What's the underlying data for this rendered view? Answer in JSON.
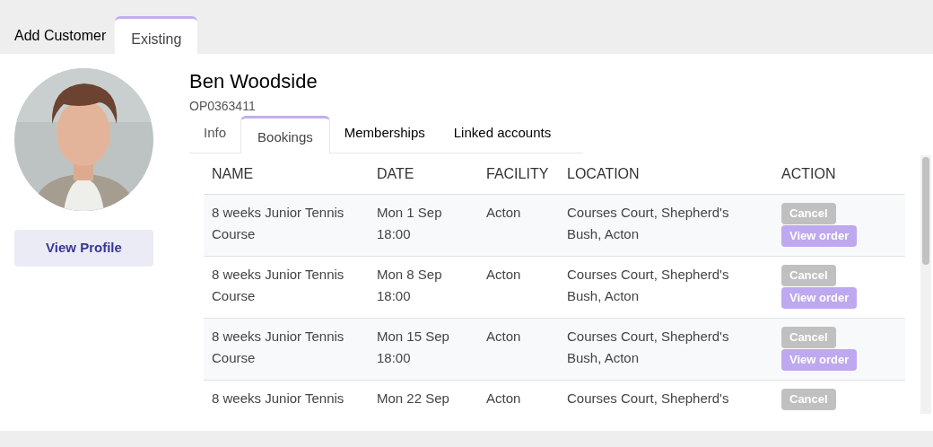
{
  "top_tabs": [
    {
      "label": "Add Customer",
      "selected": false
    },
    {
      "label": "Existing",
      "selected": true
    }
  ],
  "profile": {
    "button": "View Profile"
  },
  "customer": {
    "name": "Ben Woodside",
    "id": "OP0363411"
  },
  "tabs": [
    {
      "label": "Info",
      "selected": false
    },
    {
      "label": "Bookings",
      "selected": true
    },
    {
      "label": "Memberships",
      "selected": false
    },
    {
      "label": "Linked accounts",
      "selected": false
    }
  ],
  "table": {
    "columns": [
      "NAME",
      "DATE",
      "FACILITY",
      "LOCATION",
      "ACTION"
    ],
    "rows": [
      {
        "name": "8 weeks Junior Tennis Course",
        "date": "Mon 1 Sep 18:00",
        "facility": "Acton",
        "location": "Courses Court, Shepherd's Bush, Acton",
        "actions": [
          "Cancel",
          "View order"
        ]
      },
      {
        "name": "8 weeks Junior Tennis Course",
        "date": "Mon 8 Sep 18:00",
        "facility": "Acton",
        "location": "Courses Court, Shepherd's Bush, Acton",
        "actions": [
          "Cancel",
          "View order"
        ]
      },
      {
        "name": "8 weeks Junior Tennis Course",
        "date": "Mon 15 Sep 18:00",
        "facility": "Acton",
        "location": "Courses Court, Shepherd's Bush, Acton",
        "actions": [
          "Cancel",
          "View order"
        ]
      },
      {
        "name": "8 weeks Junior Tennis",
        "date": "Mon 22 Sep",
        "facility": "Acton",
        "location": "Courses Court, Shepherd's",
        "actions": [
          "Cancel"
        ]
      }
    ]
  }
}
